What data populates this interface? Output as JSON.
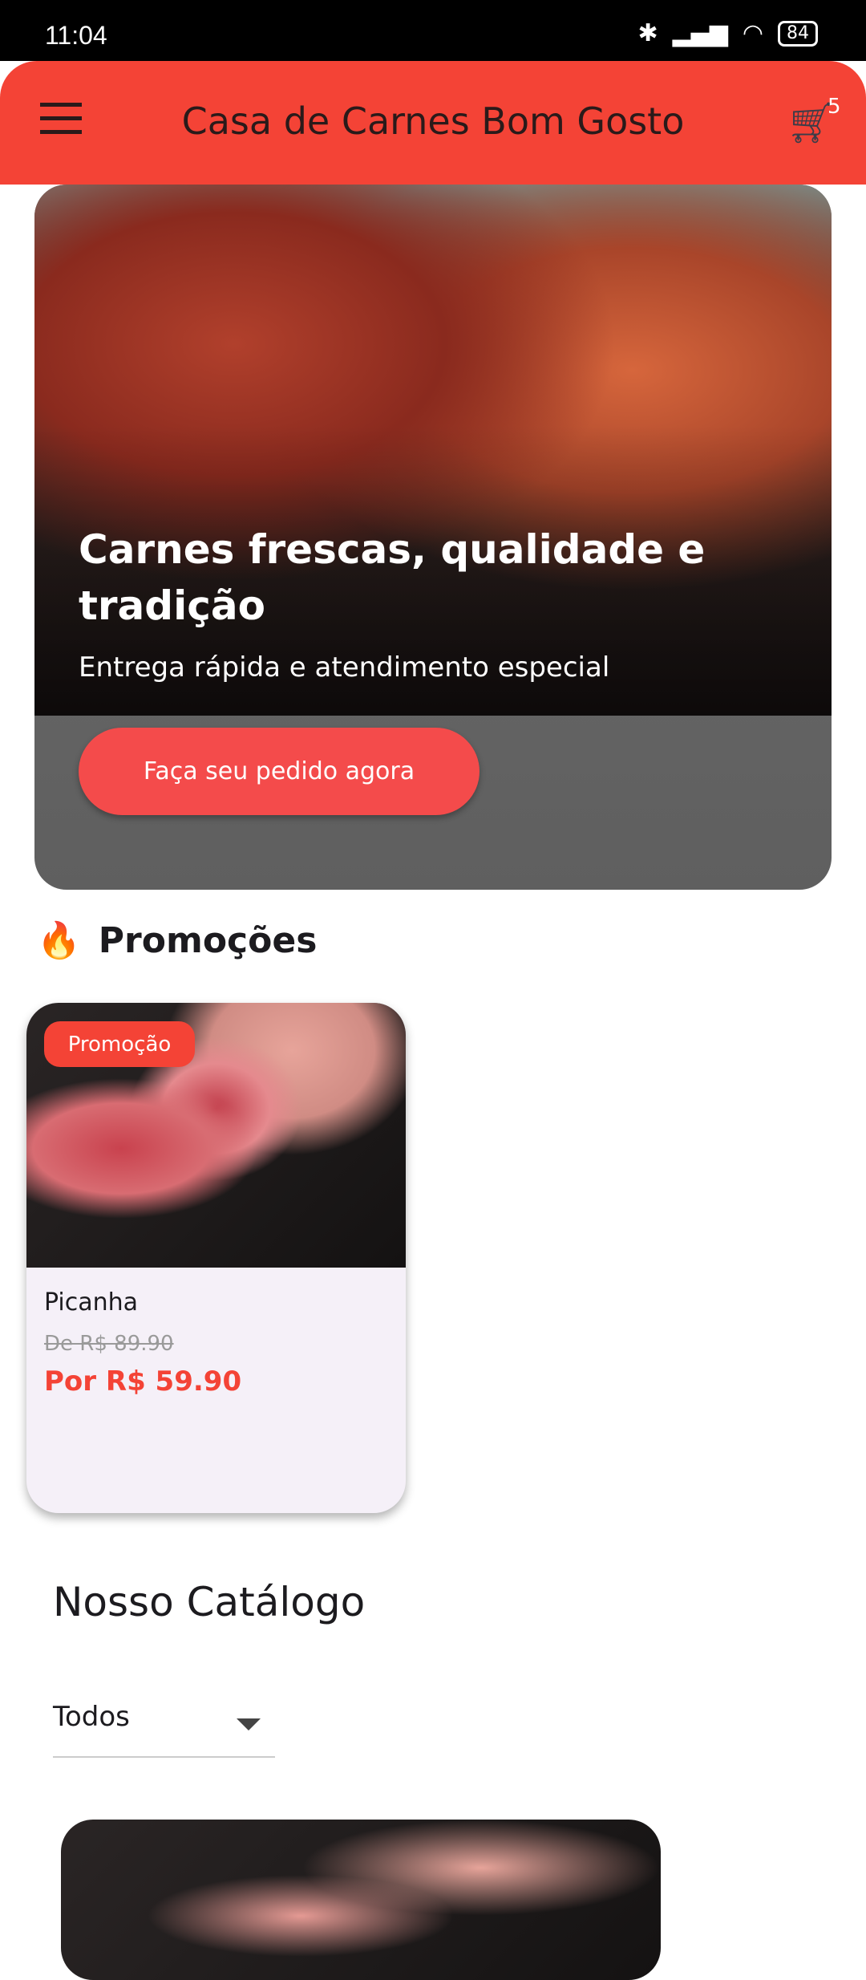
{
  "status_bar": {
    "time": "11:04",
    "battery": "84"
  },
  "app_bar": {
    "title": "Casa de Carnes Bom Gosto",
    "cart_count": "5",
    "accent": "#F44336"
  },
  "banner": {
    "title": "Carnes frescas, qualidade e tradição",
    "subtitle": "Entrega rápida e atendimento especial",
    "button": "Faça seu pedido agora"
  },
  "promotions": {
    "heading": "Promoções",
    "icon": "🔥",
    "items": [
      {
        "badge": "Promoção",
        "name": "Picanha",
        "old_price": "De R$ 89.90",
        "new_price": "Por R$ 59.90"
      }
    ]
  },
  "catalog": {
    "heading": "Nosso Catálogo",
    "filter": "Todos"
  }
}
